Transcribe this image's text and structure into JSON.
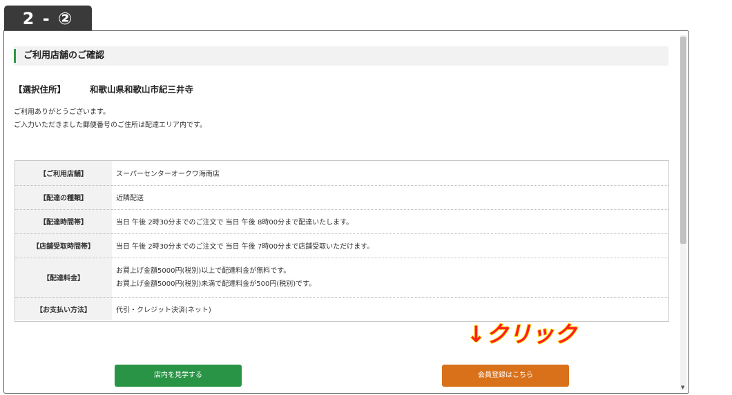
{
  "step_badge": "2 - ②",
  "section": {
    "title": "ご利用店舗のご確認"
  },
  "address": {
    "label": "【選択住所】",
    "value": "和歌山県和歌山市紀三井寺"
  },
  "message": {
    "line1": "ご利用ありがとうございます。",
    "line2": "ご入力いただきました郵便番号のご住所は配達エリア内です。"
  },
  "table": {
    "rows": [
      {
        "label": "【ご利用店舗】",
        "value": "スーパーセンターオークワ海南店"
      },
      {
        "label": "【配達の種類】",
        "value": "近隣配送"
      },
      {
        "label": "【配達時間帯】",
        "value": "当日 午後 2時30分までのご注文で 当日 午後 8時00分まで配達いたします。"
      },
      {
        "label": "【店舗受取時間帯】",
        "value": "当日 午後 2時30分までのご注文で 当日 午後 7時00分まで店舗受取いただけます。"
      },
      {
        "label": "【配達料金】",
        "value_line1": "お買上げ金額5000円(税別)以上で配達料金が無料です。",
        "value_line2": "お買上げ金額5000円(税別)未満で配達料金が500円(税別)です。"
      },
      {
        "label": "【お支払い方法】",
        "value": "代引・クレジット決済(ネット)"
      }
    ]
  },
  "buttons": {
    "browse": "店内を見学する",
    "register": "会員登録はこちら"
  },
  "annotation": "↓クリック",
  "colors": {
    "accent_green": "#2a9446",
    "accent_orange": "#d9711b",
    "annotation_red": "#ff1f1f",
    "annotation_outline": "#ffe81f"
  }
}
